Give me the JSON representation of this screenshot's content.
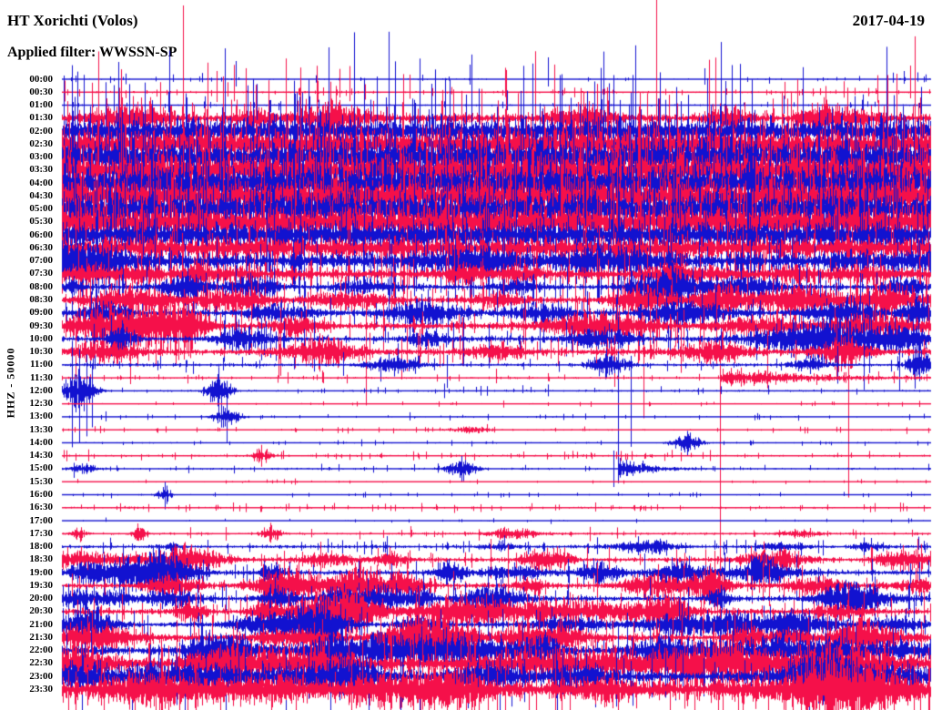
{
  "header": {
    "station": "HT Xorichti (Volos)",
    "filter": "Applied filter: WWSSN-SP",
    "date": "2017-04-19"
  },
  "chart_data": {
    "type": "helicorder-seismogram",
    "title": "HT Xorichti (Volos)",
    "date": "2017-04-19",
    "applied_filter": "WWSSN-SP",
    "channel": "HHZ",
    "scale": 50000,
    "y_axis_label": "HHZ - 50000",
    "minutes_per_row": 30,
    "rows_per_day": 48,
    "grid": "off",
    "legend": "none",
    "trace_colors": {
      "b": "#1212d0",
      "r": "#f5104a"
    },
    "color_rule": "on-the-hour rows blue, half-hour rows red",
    "activity_summary": [
      {
        "period": "00:00-01:00",
        "level": "quiet"
      },
      {
        "period": "01:30-07:30",
        "level": "very high continuous noise (clipped band)"
      },
      {
        "period": "08:00-11:00",
        "level": "moderate with frequent bursts and clipped spikes"
      },
      {
        "period": "11:30-17:30",
        "level": "quiet with isolated small events"
      },
      {
        "period": "18:00-23:30",
        "level": "increasing bursty noise, strongest after 22:00"
      }
    ],
    "notable_events": [
      {
        "row": "11:30",
        "position_fraction": 0.76,
        "description": "sharp onset spike with decaying coda and full-height clipped line"
      },
      {
        "row": "12:00",
        "position_fraction": 0.02,
        "description": "cluster of clipped spikes crossing several rows"
      },
      {
        "row": "15:00",
        "position_fraction": 0.64,
        "description": "small local event with coda"
      },
      {
        "row": "16:00",
        "position_fraction": 0.12,
        "description": "small isolated spike"
      }
    ],
    "rows": [
      {
        "t": "00:00",
        "c": "b",
        "a": 1.2,
        "tk": 0.6,
        "s": [
          [
            0.002,
            4,
            100
          ],
          [
            0.2,
            20,
            8
          ],
          [
            0.47,
            16,
            6
          ],
          [
            0.56,
            24,
            8
          ],
          [
            0.74,
            12,
            6
          ],
          [
            0.97,
            9,
            5
          ]
        ],
        "as": [
          8,
          8,
          6
        ]
      },
      {
        "t": "00:30",
        "c": "r",
        "a": 1.6,
        "tk": 1.4,
        "s": [
          [
            0.198,
            30,
            10
          ],
          [
            0.545,
            45,
            140
          ],
          [
            0.9,
            12,
            6
          ]
        ],
        "as": [
          15,
          30,
          12
        ]
      },
      {
        "t": "01:00",
        "c": "b",
        "a": 1.4,
        "tk": 0.8,
        "s": [
          [
            0.06,
            22,
            10
          ],
          [
            0.27,
            14,
            8
          ],
          [
            0.575,
            34,
            18
          ],
          [
            0.63,
            24,
            12
          ],
          [
            0.95,
            30,
            14
          ],
          [
            0.99,
            20,
            10
          ]
        ],
        "as": [
          10,
          18,
          10
        ]
      },
      {
        "t": "01:30",
        "c": "r",
        "a": 8,
        "ab": [
          8,
          8,
          20,
          0.01,
          0.03
        ],
        "as": [
          12,
          40,
          30
        ]
      },
      {
        "t": "02:00",
        "c": "b",
        "a": 24,
        "as": [
          8,
          55,
          50
        ]
      },
      {
        "t": "02:30",
        "c": "r",
        "a": 30,
        "as": [
          8,
          50,
          55
        ]
      },
      {
        "t": "03:00",
        "c": "b",
        "a": 34,
        "as": [
          8,
          60,
          50
        ]
      },
      {
        "t": "03:30",
        "c": "r",
        "a": 36,
        "as": [
          8,
          55,
          60
        ]
      },
      {
        "t": "04:00",
        "c": "b",
        "a": 38,
        "as": [
          8,
          65,
          55
        ]
      },
      {
        "t": "04:30",
        "c": "r",
        "a": 36,
        "as": [
          8,
          60,
          50
        ]
      },
      {
        "t": "05:00",
        "c": "b",
        "a": 34,
        "as": [
          8,
          55,
          60
        ]
      },
      {
        "t": "05:30",
        "c": "r",
        "a": 34,
        "as": [
          8,
          50,
          55
        ]
      },
      {
        "t": "06:00",
        "c": "b",
        "a": 26,
        "as": [
          8,
          55,
          50
        ]
      },
      {
        "t": "06:30",
        "c": "r",
        "a": 21,
        "as": [
          8,
          50,
          45
        ]
      },
      {
        "t": "07:00",
        "c": "b",
        "a": 14,
        "ab": [
          10,
          6,
          14,
          0.01,
          0.03
        ],
        "as": [
          10,
          45,
          45
        ]
      },
      {
        "t": "07:30",
        "c": "r",
        "a": 10,
        "ab": [
          10,
          5,
          12,
          0.01,
          0.03
        ],
        "as": [
          10,
          40,
          40
        ]
      },
      {
        "t": "08:00",
        "c": "b",
        "a": 5,
        "ab": [
          12,
          6,
          16,
          0.008,
          0.025
        ],
        "as": [
          16,
          35,
          45
        ]
      },
      {
        "t": "08:30",
        "c": "r",
        "a": 6.5,
        "b": [
          [
            0.08,
            0.03,
            20
          ],
          [
            0.2,
            0.025,
            16
          ],
          [
            0.33,
            0.03,
            12
          ],
          [
            0.5,
            0.02,
            10
          ],
          [
            0.67,
            0.025,
            18
          ],
          [
            0.76,
            0.02,
            25
          ],
          [
            0.85,
            0.03,
            22
          ],
          [
            0.95,
            0.025,
            25
          ]
        ],
        "s": [
          [
            0.67,
            30,
            130
          ]
        ],
        "as": [
          14,
          35,
          45
        ]
      },
      {
        "t": "09:00",
        "c": "b",
        "a": 6,
        "b": [
          [
            0.05,
            0.02,
            14
          ],
          [
            0.25,
            0.025,
            10
          ],
          [
            0.42,
            0.03,
            16
          ],
          [
            0.55,
            0.025,
            12
          ],
          [
            0.72,
            0.03,
            18
          ],
          [
            0.9,
            0.025,
            20
          ],
          [
            0.99,
            0.015,
            22
          ]
        ],
        "as": [
          12,
          30,
          40
        ]
      },
      {
        "t": "09:30",
        "c": "r",
        "a": 6.5,
        "b": [
          [
            0.04,
            0.025,
            22
          ],
          [
            0.1,
            0.03,
            30
          ],
          [
            0.14,
            0.02,
            26
          ],
          [
            0.27,
            0.02,
            14
          ],
          [
            0.62,
            0.04,
            20
          ],
          [
            0.8,
            0.03,
            12
          ],
          [
            0.93,
            0.04,
            16
          ]
        ],
        "as": [
          12,
          35,
          40
        ]
      },
      {
        "t": "10:00",
        "c": "b",
        "a": 5,
        "b": [
          [
            0.07,
            0.01,
            20
          ],
          [
            0.21,
            0.02,
            16
          ],
          [
            0.42,
            0.015,
            10
          ],
          [
            0.62,
            0.025,
            14
          ],
          [
            0.88,
            0.05,
            30
          ],
          [
            0.97,
            0.02,
            16
          ]
        ],
        "as": [
          12,
          30,
          40
        ]
      },
      {
        "t": "10:30",
        "c": "r",
        "a": 6,
        "b": [
          [
            0.05,
            0.025,
            14
          ],
          [
            0.3,
            0.03,
            18
          ],
          [
            0.5,
            0.02,
            12
          ],
          [
            0.75,
            0.025,
            16
          ],
          [
            0.9,
            0.02,
            20
          ]
        ],
        "s": [
          [
            0.906,
            25,
            160
          ],
          [
            0.35,
            55,
            55
          ]
        ],
        "as": [
          12,
          35,
          40
        ]
      },
      {
        "t": "11:00",
        "c": "b",
        "a": 2.6,
        "b": [
          [
            0.38,
            0.02,
            12
          ],
          [
            0.63,
            0.015,
            16
          ],
          [
            0.86,
            0.015,
            10
          ],
          [
            0.985,
            0.008,
            28
          ]
        ],
        "s": [
          [
            0.64,
            15,
            130
          ],
          [
            0.655,
            10,
            90
          ]
        ],
        "as": [
          8,
          25,
          30
        ]
      },
      {
        "t": "11:30",
        "c": "r",
        "a": 1.6,
        "tk": 1.2,
        "b": [
          [
            0.758,
            0.09,
            14,
            1
          ]
        ],
        "s": [
          [
            0.758,
            14,
            348
          ],
          [
            0.3,
            8,
            5
          ],
          [
            0.5,
            10,
            6
          ],
          [
            0.9,
            6,
            5
          ]
        ]
      },
      {
        "t": "12:00",
        "c": "b",
        "a": 1.6,
        "b": [
          [
            0.02,
            0.012,
            26
          ],
          [
            0.18,
            0.01,
            20
          ]
        ],
        "s": [
          [
            0.012,
            55,
            62
          ],
          [
            0.02,
            46,
            57
          ],
          [
            0.028,
            40,
            50
          ],
          [
            0.035,
            30,
            40
          ],
          [
            0.18,
            26,
            30
          ],
          [
            0.44,
            8,
            8
          ],
          [
            0.56,
            7,
            6
          ]
        ]
      },
      {
        "t": "12:30",
        "c": "r",
        "a": 1.0,
        "tk": 0.9
      },
      {
        "t": "13:00",
        "c": "b",
        "a": 1.1,
        "b": [
          [
            0.19,
            0.01,
            16
          ]
        ],
        "s": [
          [
            0.19,
            25,
            28
          ],
          [
            0.05,
            6,
            5
          ],
          [
            0.4,
            5,
            4
          ]
        ]
      },
      {
        "t": "13:30",
        "c": "r",
        "a": 1.2,
        "b": [
          [
            0.47,
            0.015,
            5
          ]
        ]
      },
      {
        "t": "14:00",
        "c": "b",
        "a": 1.2,
        "b": [
          [
            0.72,
            0.012,
            12
          ]
        ],
        "s": [
          [
            0.72,
            13,
            14
          ]
        ]
      },
      {
        "t": "14:30",
        "c": "r",
        "a": 1.6,
        "tk": 1.2,
        "b": [
          [
            0.23,
            0.008,
            9
          ]
        ],
        "s": [
          [
            0.005,
            6,
            6
          ],
          [
            0.03,
            7,
            6
          ],
          [
            0.23,
            12,
            12
          ]
        ]
      },
      {
        "t": "15:00",
        "c": "b",
        "a": 1.6,
        "b": [
          [
            0.025,
            0.01,
            7
          ],
          [
            0.46,
            0.012,
            13
          ],
          [
            0.64,
            0.03,
            16,
            1
          ]
        ],
        "s": [
          [
            0.635,
            20,
            20
          ],
          [
            0.46,
            14,
            14
          ]
        ]
      },
      {
        "t": "15:30",
        "c": "r",
        "a": 1.0,
        "tk": 0.8
      },
      {
        "t": "16:00",
        "c": "b",
        "a": 1.0,
        "b": [
          [
            0.118,
            0.006,
            10
          ]
        ],
        "s": [
          [
            0.118,
            14,
            16
          ]
        ]
      },
      {
        "t": "16:30",
        "c": "r",
        "a": 1.5,
        "tk": 1.6
      },
      {
        "t": "17:00",
        "c": "b",
        "a": 1.0,
        "tk": 0.5
      },
      {
        "t": "17:30",
        "c": "r",
        "a": 2.0,
        "b": [
          [
            0.02,
            0.006,
            8
          ],
          [
            0.09,
            0.006,
            8
          ],
          [
            0.24,
            0.008,
            10
          ],
          [
            0.52,
            0.02,
            7
          ],
          [
            0.85,
            0.015,
            5
          ]
        ],
        "s": [
          [
            0.24,
            12,
            10
          ]
        ]
      },
      {
        "t": "18:00",
        "c": "b",
        "a": 2.8,
        "tk": 1.6,
        "ab": [
          6,
          3,
          6,
          0.01,
          0.03
        ]
      },
      {
        "t": "18:30",
        "c": "r",
        "a": 4,
        "ab": [
          10,
          8,
          16,
          0.008,
          0.03
        ],
        "as": [
          8,
          25,
          30
        ]
      },
      {
        "t": "19:00",
        "c": "b",
        "a": 4.5,
        "ab": [
          12,
          8,
          18,
          0.008,
          0.03
        ],
        "as": [
          8,
          25,
          35
        ]
      },
      {
        "t": "19:30",
        "c": "r",
        "a": 5,
        "ab": [
          12,
          8,
          18,
          0.01,
          0.03
        ],
        "as": [
          8,
          30,
          35
        ]
      },
      {
        "t": "20:00",
        "c": "b",
        "a": 4.5,
        "ab": [
          12,
          8,
          18,
          0.008,
          0.03
        ],
        "as": [
          8,
          25,
          35
        ]
      },
      {
        "t": "20:30",
        "c": "r",
        "a": 5.5,
        "b": [
          [
            0.33,
            0.02,
            26
          ]
        ],
        "ab": [
          12,
          8,
          20,
          0.01,
          0.035
        ],
        "as": [
          8,
          30,
          35
        ]
      },
      {
        "t": "21:00",
        "c": "b",
        "a": 5,
        "b": [
          [
            0.3,
            0.02,
            24
          ]
        ],
        "ab": [
          12,
          8,
          16,
          0.008,
          0.03
        ],
        "as": [
          8,
          25,
          35
        ]
      },
      {
        "t": "21:30",
        "c": "r",
        "a": 6.5,
        "ab": [
          14,
          8,
          18,
          0.01,
          0.035
        ],
        "as": [
          8,
          30,
          35
        ]
      },
      {
        "t": "22:00",
        "c": "b",
        "a": 8,
        "ab": [
          14,
          10,
          18,
          0.01,
          0.04
        ],
        "as": [
          8,
          30,
          40
        ]
      },
      {
        "t": "22:30",
        "c": "r",
        "a": 13,
        "ab": [
          12,
          10,
          18,
          0.015,
          0.045
        ],
        "as": [
          8,
          35,
          40
        ]
      },
      {
        "t": "23:00",
        "c": "b",
        "a": 11,
        "ab": [
          12,
          10,
          16,
          0.012,
          0.04
        ],
        "as": [
          8,
          30,
          40
        ]
      },
      {
        "t": "23:30",
        "c": "r",
        "a": 17,
        "ab": [
          10,
          8,
          16,
          0.02,
          0.05
        ],
        "as": [
          8,
          35,
          45
        ]
      }
    ]
  }
}
